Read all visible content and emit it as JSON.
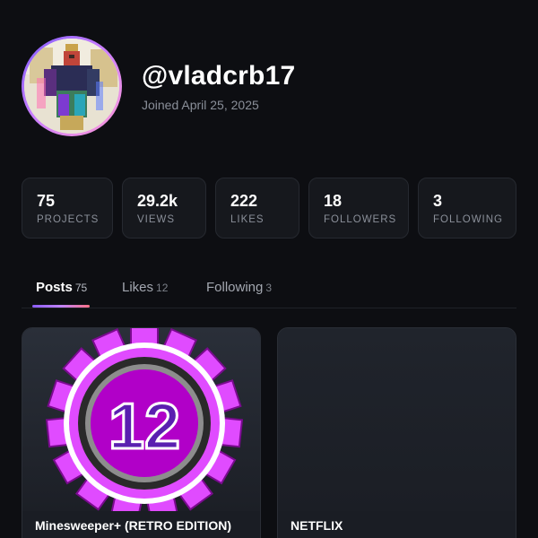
{
  "profile": {
    "username": "@vladcrb17",
    "joined": "Joined April 25, 2025"
  },
  "stats": [
    {
      "value": "75",
      "label": "PROJECTS"
    },
    {
      "value": "29.2k",
      "label": "VIEWS"
    },
    {
      "value": "222",
      "label": "LIKES"
    },
    {
      "value": "18",
      "label": "FOLLOWERS"
    },
    {
      "value": "3",
      "label": "FOLLOWING"
    }
  ],
  "tabs": [
    {
      "label": "Posts",
      "count": "75"
    },
    {
      "label": "Likes",
      "count": "12"
    },
    {
      "label": "Following",
      "count": "3"
    }
  ],
  "posts": [
    {
      "title": "Minesweeper+ (RETRO EDITION)",
      "badge": "12"
    },
    {
      "title": "NETFLIX"
    }
  ],
  "colors": {
    "background": "#0d0e12",
    "card": "#16181d",
    "accent_gradient": [
      "#8b5cf6",
      "#c084fc",
      "#fb7185"
    ],
    "badge_purple": "#b100c8",
    "badge_gear": "#e04bff"
  }
}
